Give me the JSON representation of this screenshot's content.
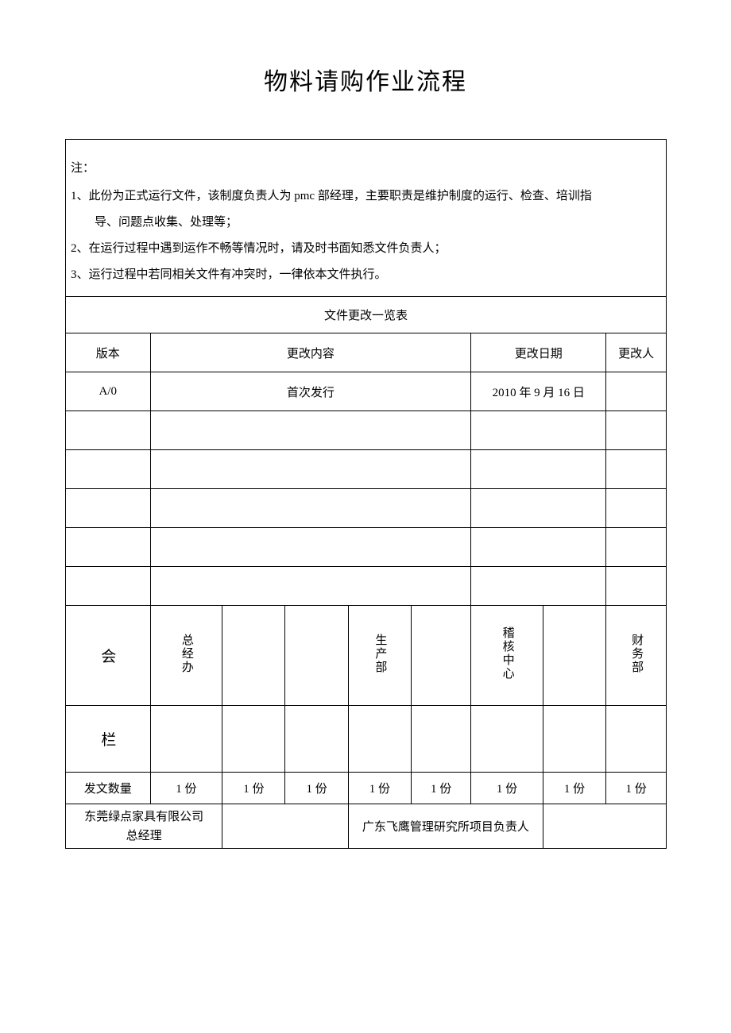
{
  "title": "物料请购作业流程",
  "notes": {
    "label": "注：",
    "item1a": "1、此份为正式运行文件，该制度负责人为 pmc 部经理，主要职责是维护制度的运行、检查、培训指",
    "item1b": "导、问题点收集、处理等；",
    "item2": "2、在运行过程中遇到运作不畅等情况时，请及时书面知悉文件负责人；",
    "item3": "3、运行过程中若同相关文件有冲突时，一律依本文件执行。"
  },
  "change_table": {
    "title": "文件更改一览表",
    "headers": {
      "version": "版本",
      "content": "更改内容",
      "date": "更改日期",
      "changer": "更改人"
    },
    "row1": {
      "version": "A/0",
      "content": "首次发行",
      "date": "2010 年 9 月 16 日",
      "changer": ""
    }
  },
  "signoff": {
    "side1": "会",
    "side2": "栏",
    "dept1": "总经办",
    "dept2": "生产部",
    "dept3": "稽核中心",
    "dept4": "财务部"
  },
  "dispatch": {
    "label": "发文数量",
    "q1": "1 份",
    "q2": "1 份",
    "q3": "1 份",
    "q4": "1 份",
    "q5": "1 份",
    "q6": "1 份",
    "q7": "1 份",
    "q8": "1 份"
  },
  "footer": {
    "left_line1": "东莞绿点家具有限公司",
    "left_line2": "总经理",
    "right": "广东飞鹰管理研究所项目负责人"
  }
}
